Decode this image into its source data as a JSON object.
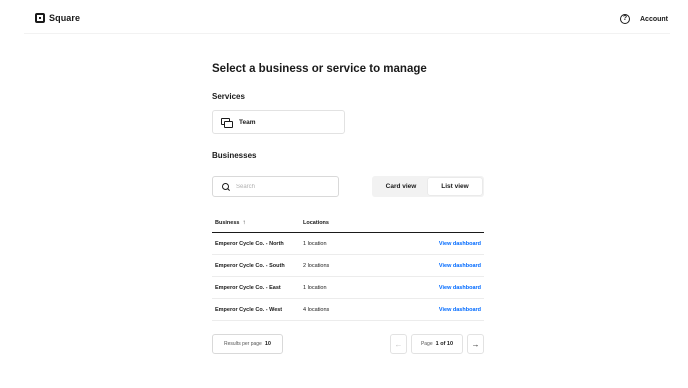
{
  "header": {
    "brand": "Square",
    "account_label": "Account",
    "help_glyph": "?"
  },
  "main": {
    "title": "Select a business or service to manage",
    "services_heading": "Services",
    "services": [
      {
        "label": "Team",
        "icon": "team-icon"
      }
    ],
    "businesses_heading": "Businesses",
    "search": {
      "placeholder": "Search",
      "value": ""
    },
    "view_toggle": {
      "card_label": "Card view",
      "list_label": "List view",
      "selected": "list"
    }
  },
  "table": {
    "headers": {
      "business": "Business",
      "sort_glyph": "↑",
      "locations": "Locations"
    },
    "rows": [
      {
        "business": "Emperor Cycle Co. - North",
        "locations": "1 location",
        "action": "View dashboard"
      },
      {
        "business": "Emperor Cycle Co. - South",
        "locations": "2 locations",
        "action": "View dashboard"
      },
      {
        "business": "Emperor Cycle Co. - East",
        "locations": "1 location",
        "action": "View dashboard"
      },
      {
        "business": "Emperor Cycle Co. - West",
        "locations": "4 locations",
        "action": "View dashboard"
      }
    ]
  },
  "pagination": {
    "results_per_page_label": "Results per page",
    "results_per_page_value": "10",
    "page_label": "Page",
    "page_value": "1 of 10",
    "prev_glyph": "←",
    "next_glyph": "→"
  },
  "colors": {
    "link": "#006aff",
    "text": "#1a1a1a"
  }
}
